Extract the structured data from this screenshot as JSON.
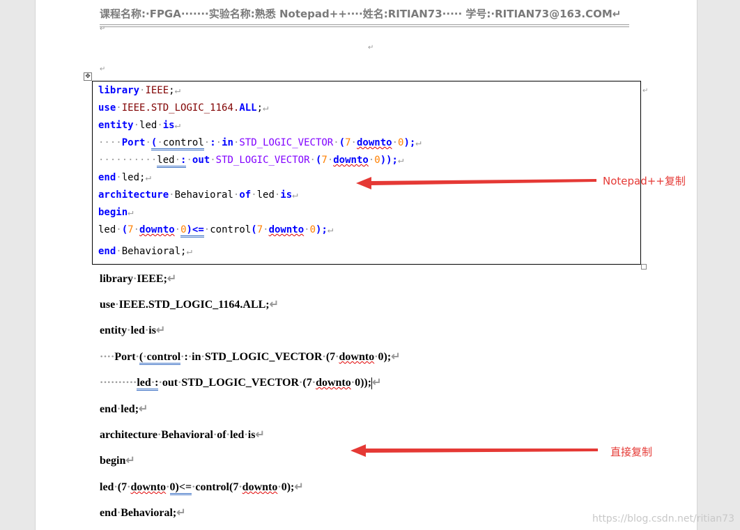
{
  "document": {
    "header": "课程名称:·FPGA·······实验名称:熟悉 Notepad++····姓名:RITIAN73····· 学号:·RITIAN73@163.COM↵",
    "para_mark": "↵",
    "table_move_symbol": "✥"
  },
  "code_block": {
    "lines": [
      [
        {
          "t": "library",
          "c": "kw"
        },
        {
          "t": "·",
          "c": "dots"
        },
        {
          "t": "IEEE",
          "c": "id"
        },
        {
          "t": ";",
          "c": ""
        },
        {
          "t": "↵",
          "c": "dots"
        }
      ],
      [
        {
          "t": "use",
          "c": "kw"
        },
        {
          "t": "·",
          "c": "dots"
        },
        {
          "t": "IEEE.STD_LOGIC_1164.",
          "c": "id"
        },
        {
          "t": "ALL",
          "c": "kw"
        },
        {
          "t": ";",
          "c": ""
        },
        {
          "t": "↵",
          "c": "dots"
        }
      ],
      [
        {
          "t": "entity",
          "c": "kw"
        },
        {
          "t": "·",
          "c": "dots"
        },
        {
          "t": "led",
          "c": ""
        },
        {
          "t": "·",
          "c": "dots"
        },
        {
          "t": "is",
          "c": "kw"
        },
        {
          "t": "↵",
          "c": "dots"
        }
      ],
      [
        {
          "t": "····",
          "c": "dots"
        },
        {
          "t": "Port",
          "c": "kw"
        },
        {
          "t": "·",
          "c": "dots"
        },
        {
          "t": "(",
          "c": "kw dbl"
        },
        {
          "t": "·",
          "c": "dots dbl"
        },
        {
          "t": "control",
          "c": "dbl"
        },
        {
          "t": "·",
          "c": "dots"
        },
        {
          "t": ":",
          "c": "kw"
        },
        {
          "t": "·",
          "c": "dots"
        },
        {
          "t": "in",
          "c": "kw"
        },
        {
          "t": "·",
          "c": "dots"
        },
        {
          "t": "STD_LOGIC_VECTOR",
          "c": "ty"
        },
        {
          "t": "·",
          "c": "dots"
        },
        {
          "t": "(",
          "c": "kw"
        },
        {
          "t": "7",
          "c": "num"
        },
        {
          "t": "·",
          "c": "dots"
        },
        {
          "t": "downto",
          "c": "kw squig"
        },
        {
          "t": "·",
          "c": "dots"
        },
        {
          "t": "0",
          "c": "num"
        },
        {
          "t": ");",
          "c": "kw"
        },
        {
          "t": "↵",
          "c": "dots"
        }
      ],
      [
        {
          "t": "··········",
          "c": "dots"
        },
        {
          "t": "led",
          "c": "dbl"
        },
        {
          "t": "·",
          "c": "dots dbl"
        },
        {
          "t": ":",
          "c": "kw dbl"
        },
        {
          "t": "·",
          "c": "dots"
        },
        {
          "t": "out",
          "c": "kw"
        },
        {
          "t": "·",
          "c": "dots"
        },
        {
          "t": "STD_LOGIC_VECTOR",
          "c": "ty"
        },
        {
          "t": "·",
          "c": "dots"
        },
        {
          "t": "(",
          "c": "kw"
        },
        {
          "t": "7",
          "c": "num"
        },
        {
          "t": "·",
          "c": "dots"
        },
        {
          "t": "downto",
          "c": "kw squig"
        },
        {
          "t": "·",
          "c": "dots"
        },
        {
          "t": "0",
          "c": "num"
        },
        {
          "t": "));",
          "c": "kw"
        },
        {
          "t": "↵",
          "c": "dots"
        }
      ],
      [
        {
          "t": "end",
          "c": "kw"
        },
        {
          "t": "·",
          "c": "dots"
        },
        {
          "t": "led;",
          "c": ""
        },
        {
          "t": "↵",
          "c": "dots"
        }
      ],
      [
        {
          "t": "architecture",
          "c": "kw"
        },
        {
          "t": "·",
          "c": "dots"
        },
        {
          "t": "Behavioral",
          "c": ""
        },
        {
          "t": "·",
          "c": "dots"
        },
        {
          "t": "of",
          "c": "kw"
        },
        {
          "t": "·",
          "c": "dots"
        },
        {
          "t": "led",
          "c": ""
        },
        {
          "t": "·",
          "c": "dots"
        },
        {
          "t": "is",
          "c": "kw"
        },
        {
          "t": "↵",
          "c": "dots"
        }
      ],
      [
        {
          "t": "begin",
          "c": "kw"
        },
        {
          "t": "↵",
          "c": "dots"
        }
      ],
      [
        {
          "t": "led",
          "c": ""
        },
        {
          "t": "·",
          "c": "dots"
        },
        {
          "t": "(",
          "c": "kw"
        },
        {
          "t": "7",
          "c": "num"
        },
        {
          "t": "·",
          "c": "dots"
        },
        {
          "t": "downto",
          "c": "kw squig"
        },
        {
          "t": "·",
          "c": "dots"
        },
        {
          "t": "0",
          "c": "num dbl"
        },
        {
          "t": ")<=",
          "c": "kw dbl"
        },
        {
          "t": "·",
          "c": "dots"
        },
        {
          "t": "control",
          "c": ""
        },
        {
          "t": "(",
          "c": "kw"
        },
        {
          "t": "7",
          "c": "num"
        },
        {
          "t": "·",
          "c": "dots"
        },
        {
          "t": "downto",
          "c": "kw squig"
        },
        {
          "t": "·",
          "c": "dots"
        },
        {
          "t": "0",
          "c": "num"
        },
        {
          "t": ");",
          "c": "kw"
        },
        {
          "t": "↵",
          "c": "dots"
        }
      ],
      [
        {
          "t": "end",
          "c": "kw"
        },
        {
          "t": "·",
          "c": "dots"
        },
        {
          "t": "Behavioral;",
          "c": ""
        },
        {
          "t": "↵",
          "c": "dots"
        }
      ]
    ]
  },
  "plain_block": {
    "lines": [
      [
        {
          "t": "library"
        },
        {
          "t": "·",
          "c": "dots"
        },
        {
          "t": "IEEE;"
        },
        {
          "t": "↵",
          "c": "dots"
        }
      ],
      [
        {
          "t": "use"
        },
        {
          "t": "·",
          "c": "dots"
        },
        {
          "t": "IEEE.STD_LOGIC_1164.ALL;"
        },
        {
          "t": "↵",
          "c": "dots"
        }
      ],
      [
        {
          "t": "entity"
        },
        {
          "t": "·",
          "c": "dots"
        },
        {
          "t": "led"
        },
        {
          "t": "·",
          "c": "dots"
        },
        {
          "t": "is"
        },
        {
          "t": "↵",
          "c": "dots"
        }
      ],
      [
        {
          "t": "····",
          "c": "dots"
        },
        {
          "t": "Port"
        },
        {
          "t": "·",
          "c": "dots"
        },
        {
          "t": "(",
          "c": "dbl"
        },
        {
          "t": "·",
          "c": "dots dbl"
        },
        {
          "t": "control",
          "c": "dbl"
        },
        {
          "t": "·",
          "c": "dots"
        },
        {
          "t": ":"
        },
        {
          "t": "·",
          "c": "dots"
        },
        {
          "t": "in"
        },
        {
          "t": "·",
          "c": "dots"
        },
        {
          "t": "STD_LOGIC_VECTOR"
        },
        {
          "t": "·",
          "c": "dots"
        },
        {
          "t": "(7"
        },
        {
          "t": "·",
          "c": "dots"
        },
        {
          "t": "downto",
          "c": "squig"
        },
        {
          "t": "·",
          "c": "dots"
        },
        {
          "t": "0);"
        },
        {
          "t": "↵",
          "c": "dots"
        }
      ],
      [
        {
          "t": "··········",
          "c": "dots"
        },
        {
          "t": "led",
          "c": "dbl"
        },
        {
          "t": "·",
          "c": "dots dbl"
        },
        {
          "t": ":",
          "c": "dbl"
        },
        {
          "t": "·",
          "c": "dots"
        },
        {
          "t": "out"
        },
        {
          "t": "·",
          "c": "dots"
        },
        {
          "t": "STD_LOGIC_VECTOR"
        },
        {
          "t": "·",
          "c": "dots"
        },
        {
          "t": "(7"
        },
        {
          "t": "·",
          "c": "dots"
        },
        {
          "t": "downto",
          "c": "squig"
        },
        {
          "t": "·",
          "c": "dots"
        },
        {
          "t": "0));"
        },
        {
          "t": "",
          "c": "cursor"
        },
        {
          "t": "↵",
          "c": "dots"
        }
      ],
      [
        {
          "t": "end"
        },
        {
          "t": "·",
          "c": "dots"
        },
        {
          "t": "led;"
        },
        {
          "t": "↵",
          "c": "dots"
        }
      ],
      [
        {
          "t": "architecture"
        },
        {
          "t": "·",
          "c": "dots"
        },
        {
          "t": "Behavioral"
        },
        {
          "t": "·",
          "c": "dots"
        },
        {
          "t": "of"
        },
        {
          "t": "·",
          "c": "dots"
        },
        {
          "t": "led"
        },
        {
          "t": "·",
          "c": "dots"
        },
        {
          "t": "is"
        },
        {
          "t": "↵",
          "c": "dots"
        }
      ],
      [
        {
          "t": "begin"
        },
        {
          "t": "↵",
          "c": "dots"
        }
      ],
      [
        {
          "t": "led"
        },
        {
          "t": "·",
          "c": "dots"
        },
        {
          "t": "(7"
        },
        {
          "t": "·",
          "c": "dots"
        },
        {
          "t": "downto",
          "c": "squig"
        },
        {
          "t": "·",
          "c": "dots"
        },
        {
          "t": "0)",
          "c": "dbl"
        },
        {
          "t": "<=",
          "c": "dbl"
        },
        {
          "t": "·",
          "c": "dots"
        },
        {
          "t": "control(7"
        },
        {
          "t": "·",
          "c": "dots"
        },
        {
          "t": "downto",
          "c": "squig"
        },
        {
          "t": "·",
          "c": "dots"
        },
        {
          "t": "0);"
        },
        {
          "t": "↵",
          "c": "dots"
        }
      ],
      [
        {
          "t": "end"
        },
        {
          "t": "·",
          "c": "dots"
        },
        {
          "t": "Behavioral;"
        },
        {
          "t": "↵",
          "c": "dots"
        }
      ]
    ]
  },
  "annotations": {
    "notepad_label": "Notepad++复制",
    "direct_label": "直接复制",
    "color": "#e53935"
  },
  "watermark": "https://blog.csdn.net/ritian73",
  "colors": {
    "keyword": "#0000ff",
    "type": "#8000ff",
    "identifier": "#800000",
    "number": "#ff8000",
    "squiggle": "#e00000",
    "double_underline": "#3a6fc4"
  }
}
